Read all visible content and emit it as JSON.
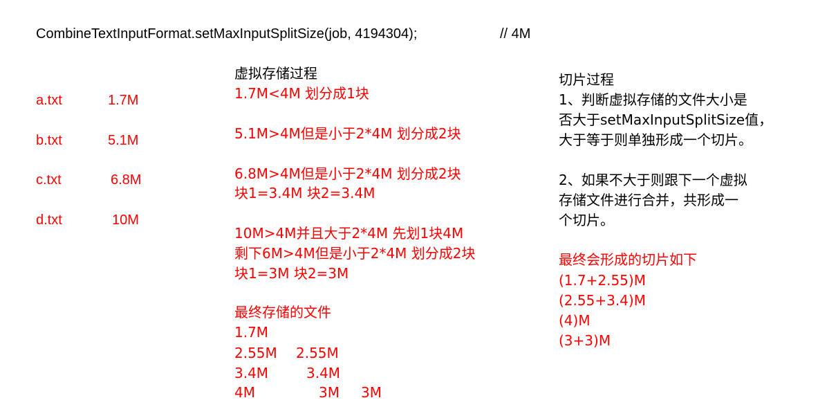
{
  "header": {
    "code": "CombineTextInputFormat.setMaxInputSplitSize(job, 4194304);",
    "comment": "// 4M"
  },
  "files": [
    {
      "name": "a.txt",
      "size": "1.7M"
    },
    {
      "name": "b.txt",
      "size": "5.1M"
    },
    {
      "name": "c.txt",
      "size": "6.8M"
    },
    {
      "name": "d.txt",
      "size": "10M"
    }
  ],
  "virtual_storage": {
    "title": "虚拟存储过程",
    "lines": [
      "1.7M<4M 划分成1块",
      "5.1M>4M但是小于2*4M 划分成2块",
      "6.8M>4M但是小于2*4M 划分成2块",
      "块1=3.4M  块2=3.4M",
      "10M>4M并且大于2*4M 先划1块4M",
      "剩下6M>4M但是小于2*4M 划分成2块",
      "块1=3M 块2=3M"
    ]
  },
  "final_files": {
    "title": "最终存储的文件",
    "rows": [
      [
        "1.7M"
      ],
      [
        "2.55M",
        "2.55M"
      ],
      [
        "3.4M",
        "3.4M"
      ],
      [
        "4M",
        "3M",
        "3M"
      ]
    ]
  },
  "split_process": {
    "title": "切片过程",
    "lines": [
      "1、判断虚拟存储的文件大小是",
      "否大于setMaxInputSplitSize值，",
      "大于等于则单独形成一个切片。",
      "2、如果不大于则跟下一个虚拟",
      "存储文件进行合并，共形成一",
      "个切片。"
    ],
    "final_title": "最终会形成的切片如下",
    "splits": [
      "(1.7+2.55)M",
      "(2.55+3.4)M",
      "(4)M",
      "(3+3)M"
    ]
  },
  "colors": {
    "red_text": "#ff0000",
    "black_text": "#000000",
    "background": "#ffffff"
  }
}
